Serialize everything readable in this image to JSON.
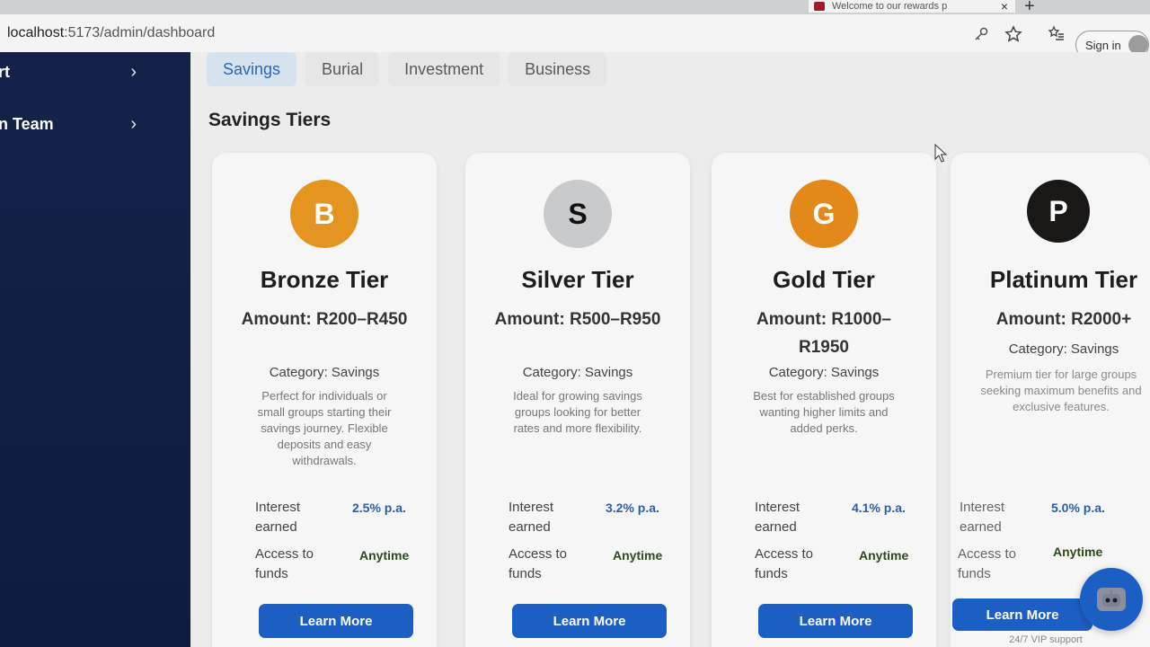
{
  "browser": {
    "url_host": "localhost",
    "url_path": ":5173/admin/dashboard",
    "tab_title": "Welcome to our rewards p",
    "tab_close": "×",
    "new_tab": "+",
    "signin_label": "Sign in"
  },
  "sidebar": {
    "items": [
      {
        "label": "rt",
        "chevron": "›"
      },
      {
        "label": "n Team",
        "chevron": "›"
      }
    ]
  },
  "main": {
    "tabs": [
      {
        "label": "Savings",
        "active": true
      },
      {
        "label": "Burial",
        "active": false
      },
      {
        "label": "Investment",
        "active": false
      },
      {
        "label": "Business",
        "active": false
      }
    ],
    "section_title": "Savings Tiers",
    "interest_label": "Interest earned",
    "access_label": "Access to funds",
    "cards": [
      {
        "letter": "B",
        "badge_color": "#e3951f",
        "name": "Bronze Tier",
        "amount": "Amount: R200–R450",
        "category": "Category: Savings",
        "description": "Perfect for individuals or small groups starting their savings journey. Flexible deposits and easy withdrawals.",
        "interest": "2.5% p.a.",
        "access": "Anytime",
        "button": "Learn More",
        "footer": ""
      },
      {
        "letter": "S",
        "badge_color": "#c9cacc",
        "name": "Silver Tier",
        "amount": "Amount: R500–R950",
        "category": "Category: Savings",
        "description": "Ideal for growing savings groups looking for better rates and more flexibility.",
        "interest": "3.2% p.a.",
        "access": "Anytime",
        "button": "Learn More",
        "footer": ""
      },
      {
        "letter": "G",
        "badge_color": "#e3891a",
        "name": "Gold Tier",
        "amount": "Amount: R1000–R1950",
        "category": "Category: Savings",
        "description": "Best for established groups wanting higher limits and added perks.",
        "interest": "4.1% p.a.",
        "access": "Anytime",
        "button": "Learn More",
        "footer": ""
      },
      {
        "letter": "P",
        "badge_color": "#1a1717",
        "name": "Platinum Tier",
        "amount": "Amount: R2000+",
        "category": "Category: Savings",
        "description": "Premium tier for large groups seeking maximum benefits and exclusive features.",
        "interest": "5.0% p.a.",
        "access": "Anytime",
        "button": "Learn More",
        "footer": "24/7 VIP support"
      }
    ]
  },
  "colors": {
    "accent": "#1c5fc4",
    "sidebar": "#14224a",
    "interest_text": "#2a5fb0",
    "access_text": "#2d4a1e"
  }
}
